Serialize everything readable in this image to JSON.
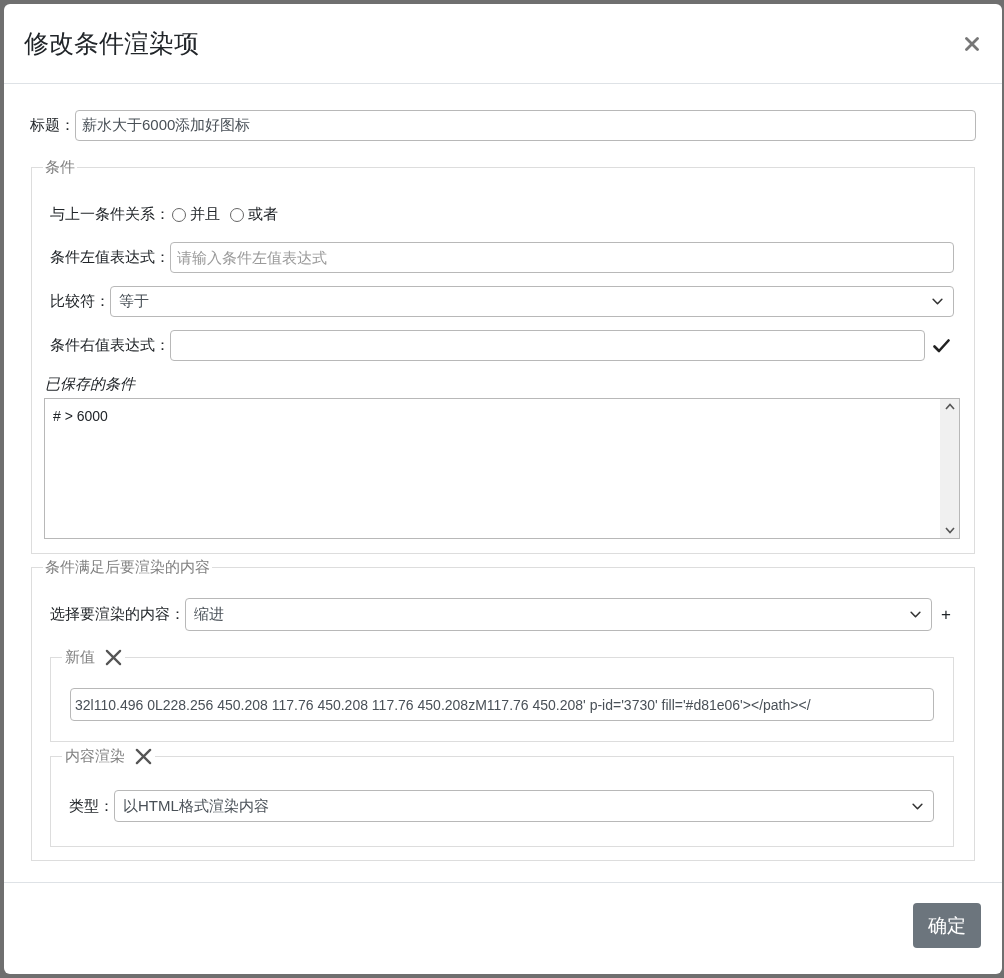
{
  "dialog": {
    "title": "修改条件渲染项"
  },
  "title_field": {
    "label": "标题：",
    "value": "薪水大于6000添加好图标"
  },
  "condition": {
    "legend": "条件",
    "relation": {
      "label": "与上一条件关系：",
      "options": [
        {
          "label": "并且",
          "selected": false
        },
        {
          "label": "或者",
          "selected": false
        }
      ]
    },
    "left_expression": {
      "label": "条件左值表达式：",
      "placeholder": "请输入条件左值表达式"
    },
    "comparator": {
      "label": "比较符：",
      "value": "等于"
    },
    "right_expression": {
      "label": "条件右值表达式："
    },
    "saved_conditions": {
      "label": "已保存的条件",
      "value": "# > 6000"
    }
  },
  "render_content": {
    "legend": "条件满足后要渲染的内容",
    "content_select": {
      "label": "选择要渲染的内容：",
      "value": "缩进"
    },
    "add_button": "+",
    "items": [
      {
        "kind": "text_input",
        "legend": "新值",
        "value": "32l110.496 0L228.256 450.208 117.76 450.208 117.76 450.208zM117.76 450.208' p-id='3730' fill='#d81e06'></path></"
      },
      {
        "kind": "select",
        "legend": "内容渲染",
        "label": "类型：",
        "value": "以HTML格式渲染内容"
      }
    ]
  },
  "footer": {
    "buttons": [
      "确定"
    ]
  }
}
